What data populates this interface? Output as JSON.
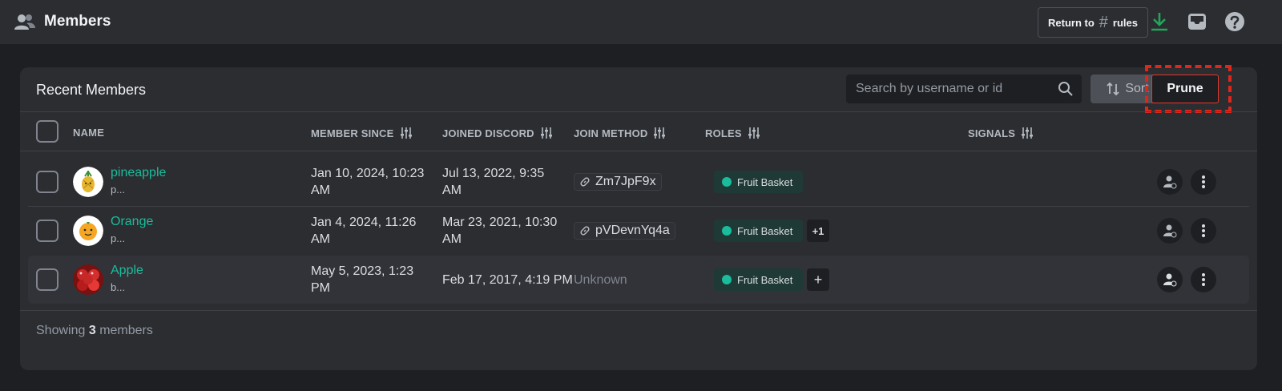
{
  "topbar": {
    "title": "Members",
    "return_label": "Return to",
    "return_hash": "#",
    "return_channel": "rules",
    "icons": [
      "members-icon",
      "download-icon",
      "inbox-icon",
      "help-icon"
    ]
  },
  "panel": {
    "title": "Recent Members",
    "search_placeholder": "Search by username or id",
    "sort_label": "Sort",
    "prune_label": "Prune"
  },
  "columns": {
    "name": "NAME",
    "member_since": "MEMBER SINCE",
    "joined_discord": "JOINED DISCORD",
    "join_method": "JOIN METHOD",
    "roles": "ROLES",
    "signals": "SIGNALS"
  },
  "members": [
    {
      "name": "pineapple",
      "sub": "p...",
      "member_since_1": "Jan 10, 2024, 10:23",
      "member_since_2": "AM",
      "joined_1": "Jul 13, 2022, 9:35",
      "joined_2": "AM",
      "join_method": "Zm7JpF9x",
      "role": "Fruit Basket",
      "extra": ""
    },
    {
      "name": "Orange",
      "sub": "p...",
      "member_since_1": "Jan 4, 2024, 11:26",
      "member_since_2": "AM",
      "joined_1": "Mar 23, 2021, 10:30",
      "joined_2": "AM",
      "join_method": "pVDevnYq4a",
      "role": "Fruit Basket",
      "extra": "+1"
    },
    {
      "name": "Apple",
      "sub": "b...",
      "member_since_1": "May 5, 2023, 1:23",
      "member_since_2": "PM",
      "joined_1": "Feb 17, 2017, 4:19 PM",
      "joined_2": "",
      "join_method": "Unknown",
      "role": "Fruit Basket",
      "extra": "+"
    }
  ],
  "footer": {
    "prefix": "Showing",
    "count": "3",
    "suffix": "members"
  },
  "colors": {
    "background": "#1e1f22",
    "panel": "#2b2d31",
    "username_green": "#23a55a",
    "role_dot": "#1abc9c",
    "download_green": "#23a55a",
    "highlight_red": "#e0261b"
  }
}
